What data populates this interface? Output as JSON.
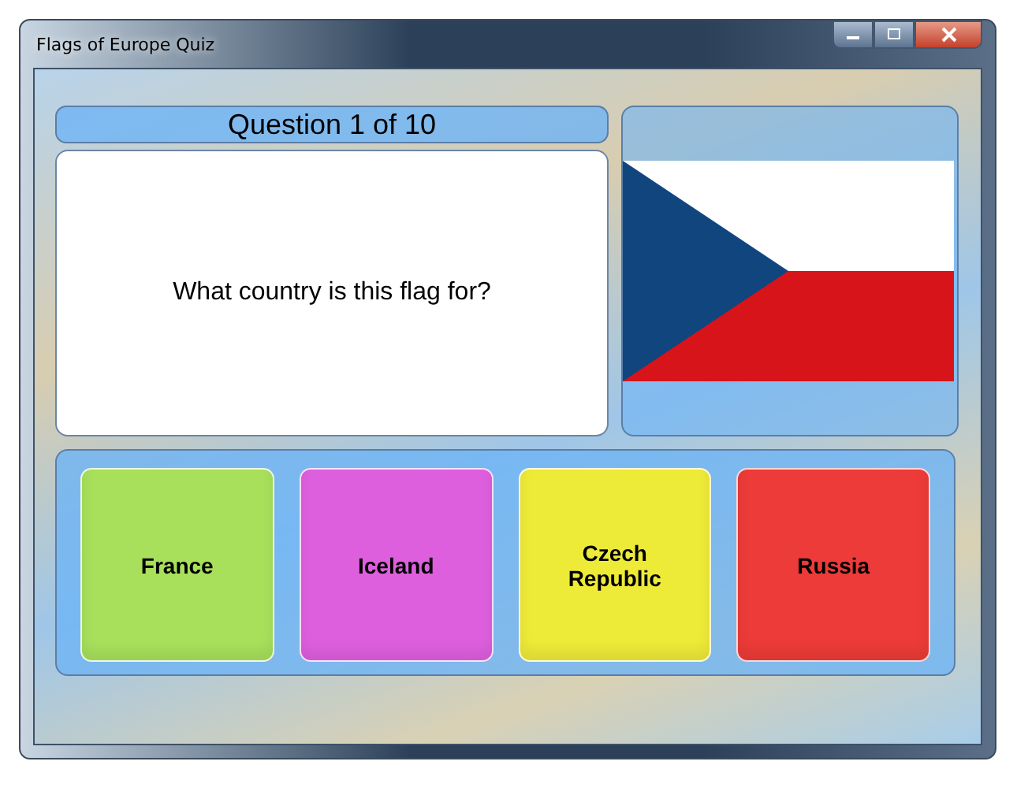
{
  "window": {
    "title": "Flags of Europe Quiz"
  },
  "question": {
    "counter": "Question 1 of 10",
    "text": "What country is this flag for?"
  },
  "answers": [
    {
      "label": "France",
      "color": "#a8e05c"
    },
    {
      "label": "Iceland",
      "color": "#de5fde"
    },
    {
      "label": "Czech Republic",
      "color": "#eeea38"
    },
    {
      "label": "Russia",
      "color": "#ec3b38"
    }
  ]
}
